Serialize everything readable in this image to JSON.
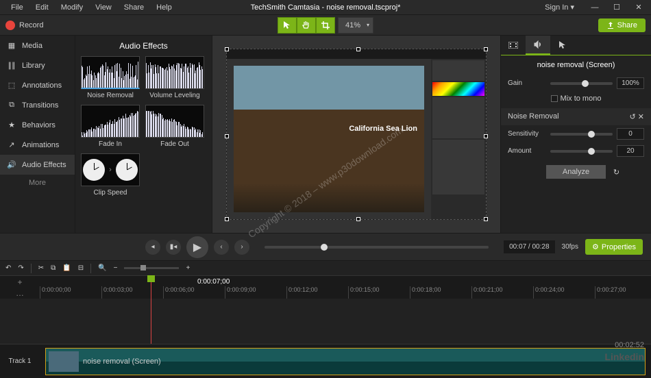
{
  "title": "TechSmith Camtasia - noise removal.tscproj*",
  "menu": {
    "file": "File",
    "edit": "Edit",
    "modify": "Modify",
    "view": "View",
    "share": "Share",
    "help": "Help"
  },
  "signin": "Sign In ▾",
  "record": "Record",
  "zoom": "41%",
  "share": "Share",
  "sidebar": {
    "items": [
      {
        "label": "Media"
      },
      {
        "label": "Library"
      },
      {
        "label": "Annotations"
      },
      {
        "label": "Transitions"
      },
      {
        "label": "Behaviors"
      },
      {
        "label": "Animations"
      },
      {
        "label": "Audio Effects"
      }
    ],
    "more": "More"
  },
  "fx": {
    "title": "Audio Effects",
    "items": [
      {
        "label": "Noise Removal"
      },
      {
        "label": "Volume Leveling"
      },
      {
        "label": "Fade In"
      },
      {
        "label": "Fade Out"
      },
      {
        "label": "Clip Speed"
      }
    ]
  },
  "canvas_text": "California Sea Lion",
  "watermark": "Copyright © 2018 – www.p30download.com",
  "props": {
    "title": "noise removal (Screen)",
    "gain": {
      "label": "Gain",
      "value": "100%"
    },
    "mix": "Mix to mono",
    "section": "Noise Removal",
    "sensitivity": {
      "label": "Sensitivity",
      "value": "0"
    },
    "amount": {
      "label": "Amount",
      "value": "20"
    },
    "analyze": "Analyze"
  },
  "play": {
    "time": "00:07 / 00:28",
    "fps": "30fps",
    "props": "Properties"
  },
  "timeline": {
    "playhead": "0:00:07;00",
    "track": "Track 1",
    "clip": "noise removal (Screen)",
    "ticks": [
      "0:00:00;00",
      "0:00:03;00",
      "0:00:06;00",
      "0:00:09;00",
      "0:00:12;00",
      "0:00:15;00",
      "0:00:18;00",
      "0:00:21;00",
      "0:00:24;00",
      "0:00:27;00"
    ]
  },
  "brand": "Linkedin",
  "elapsed": "00:02:52"
}
